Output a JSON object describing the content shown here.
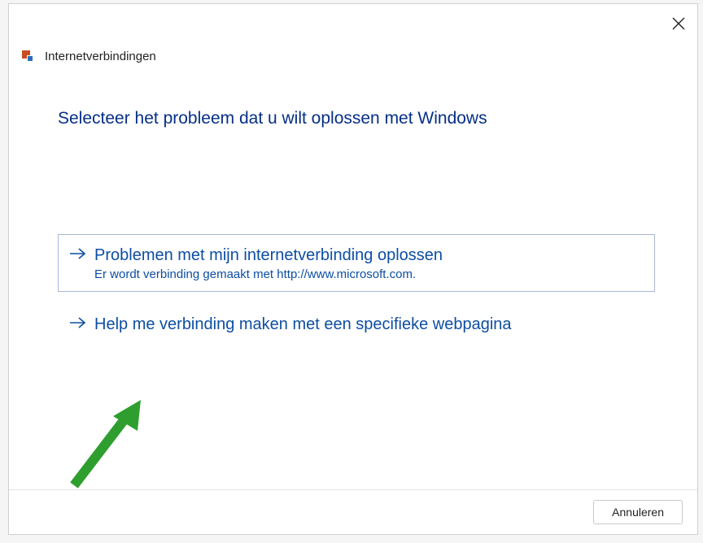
{
  "window": {
    "title": "Internetverbindingen"
  },
  "heading": "Selecteer het probleem dat u wilt oplossen met Windows",
  "options": [
    {
      "title": "Problemen met mijn internetverbinding oplossen",
      "subtitle": "Er wordt verbinding gemaakt met http://www.microsoft.com."
    },
    {
      "title": "Help me verbinding maken met een specifieke webpagina",
      "subtitle": ""
    }
  ],
  "footer": {
    "cancel_label": "Annuleren"
  }
}
